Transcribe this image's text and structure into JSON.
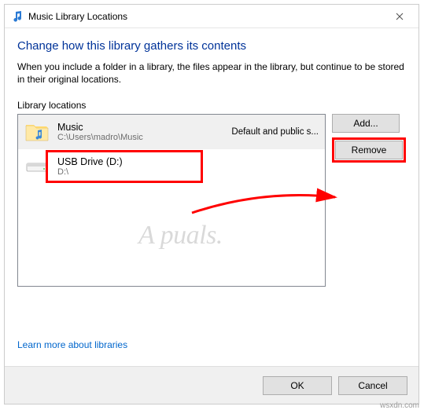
{
  "window": {
    "title": "Music Library Locations"
  },
  "heading": "Change how this library gathers its contents",
  "description": "When you include a folder in a library, the files appear in the library, but continue to be stored in their original locations.",
  "section_label": "Library locations",
  "locations": [
    {
      "name": "Music",
      "path": "C:\\Users\\madro\\Music",
      "meta": "Default and public s..."
    },
    {
      "name": "USB Drive (D:)",
      "path": "D:\\",
      "meta": ""
    }
  ],
  "buttons": {
    "add": "Add...",
    "remove": "Remove",
    "ok": "OK",
    "cancel": "Cancel"
  },
  "link_text": "Learn more about libraries",
  "watermark": "A puals.",
  "credit": "wsxdn.com"
}
